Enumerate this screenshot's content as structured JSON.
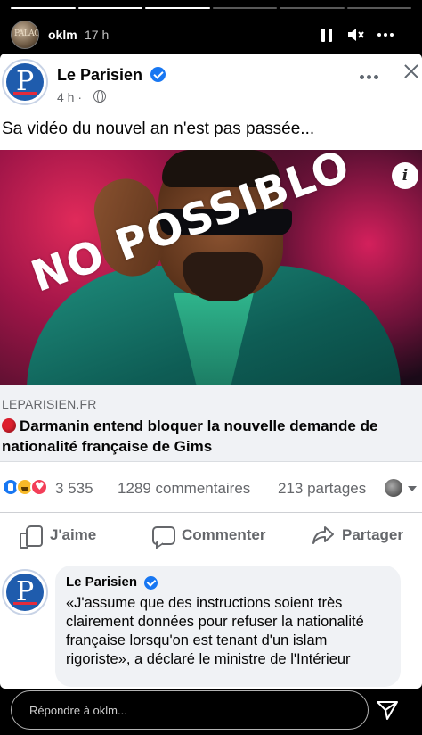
{
  "story": {
    "username": "oklm",
    "time": "17 h",
    "progress_segments": 6,
    "progress_done": 3,
    "avatar_text": "PALAO",
    "icons": [
      "pause-icon",
      "mute-icon",
      "more-icon"
    ]
  },
  "post": {
    "page_name": "Le Parisien",
    "logo_letter": "P",
    "time": "4 h ·",
    "text": "Sa vidéo du nouvel an n'est pas passée...",
    "image_overlay": "NO POSSIBLO",
    "info_glyph": "i",
    "link_domain": "LEPARISIEN.FR",
    "link_title": "Darmanin entend bloquer la nouvelle demande de nationalité française de Gims",
    "reactions": [
      "like",
      "haha",
      "love"
    ],
    "reaction_count": "3 535",
    "comments": "1289 commentaires",
    "shares": "213 partages",
    "actions": {
      "like": "J'aime",
      "comment": "Commenter",
      "share": "Partager"
    },
    "colors": {
      "facebook_blue": "#1877f2",
      "parisien_blue": "#1f5cad",
      "parisien_red": "#e32b3c"
    }
  },
  "comment": {
    "author": "Le Parisien",
    "text": "«J'assume que des instructions soient très clairement données pour refuser la nationalité française lorsqu'on est tenant d'un islam rigoriste», a déclaré le ministre de l'Intérieur"
  },
  "reply": {
    "placeholder": "Répondre à oklm..."
  }
}
